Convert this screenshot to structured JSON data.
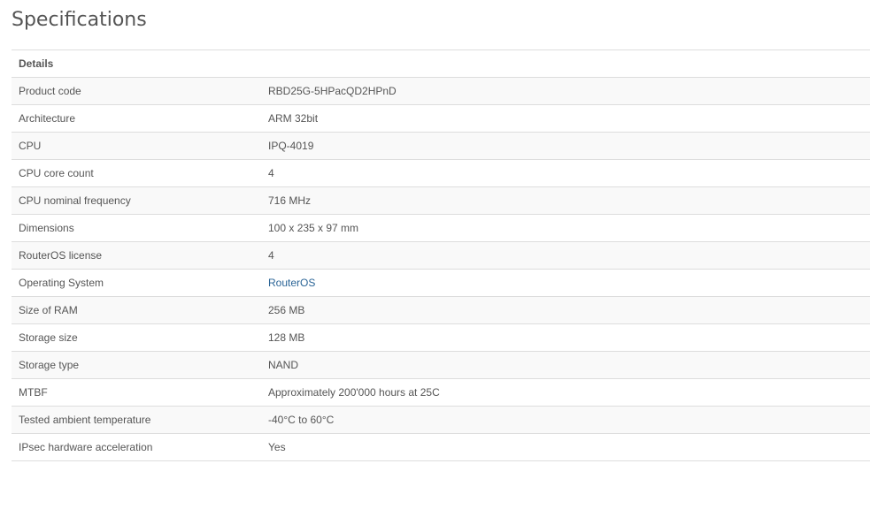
{
  "page": {
    "title": "Specifications"
  },
  "table": {
    "header": "Details",
    "rows": [
      {
        "label": "Product code",
        "value": "RBD25G-5HPacQD2HPnD",
        "link": false
      },
      {
        "label": "Architecture",
        "value": "ARM 32bit",
        "link": false
      },
      {
        "label": "CPU",
        "value": "IPQ-4019",
        "link": false
      },
      {
        "label": "CPU core count",
        "value": "4",
        "link": false
      },
      {
        "label": "CPU nominal frequency",
        "value": "716 MHz",
        "link": false
      },
      {
        "label": "Dimensions",
        "value": "100 x 235 x 97 mm",
        "link": false
      },
      {
        "label": "RouterOS license",
        "value": "4",
        "link": false
      },
      {
        "label": "Operating System",
        "value": "RouterOS",
        "link": true
      },
      {
        "label": "Size of RAM",
        "value": "256 MB",
        "link": false
      },
      {
        "label": "Storage size",
        "value": "128 MB",
        "link": false
      },
      {
        "label": "Storage type",
        "value": "NAND",
        "link": false
      },
      {
        "label": "MTBF",
        "value": "Approximately 200'000 hours at 25C",
        "link": false
      },
      {
        "label": "Tested ambient temperature",
        "value": "-40°C to 60°C",
        "link": false
      },
      {
        "label": "IPsec hardware acceleration",
        "value": "Yes",
        "link": false
      }
    ]
  },
  "colors": {
    "text": "#555555",
    "link": "#2a6496",
    "stripe": "#f9f9f9",
    "border": "#dddddd"
  }
}
